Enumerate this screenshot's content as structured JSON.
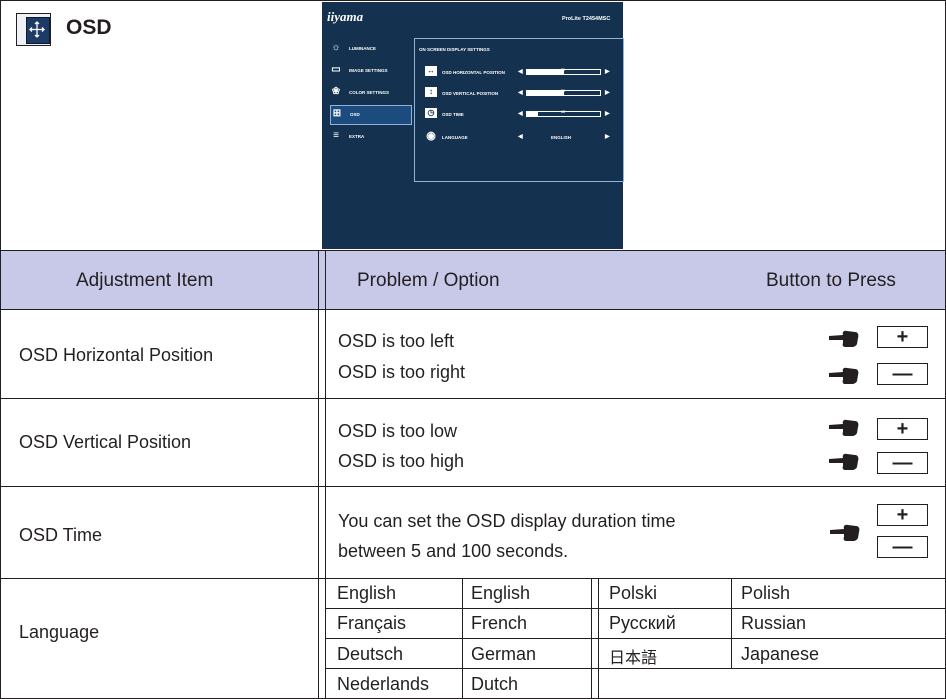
{
  "header": {
    "title": "OSD"
  },
  "monitor": {
    "brand": "iiyama",
    "model": "ProLite T2454MSC",
    "menu": [
      {
        "label": "LUMINANCE",
        "icon": "sun-icon"
      },
      {
        "label": "IMAGE SETTINGS",
        "icon": "image-icon"
      },
      {
        "label": "COLOR SETTINGS",
        "icon": "color-icon"
      },
      {
        "label": "OSD",
        "icon": "osd-icon"
      },
      {
        "label": "EXTRA",
        "icon": "sliders-icon"
      }
    ],
    "panel_title": "ON SCREEN DISPLAY SETTINGS",
    "rows": [
      {
        "label": "OSD HORIZONTAL POSITION",
        "value": "50",
        "level": 0.5
      },
      {
        "label": "OSD VERTICAL POSITION",
        "value": "50",
        "level": 0.5
      },
      {
        "label": "OSD TIME",
        "value": "15",
        "level": 0.15
      }
    ],
    "language_row": {
      "label": "LANGUAGE",
      "value": "ENGLISH"
    }
  },
  "table": {
    "col_adjustment": "Adjustment Item",
    "col_problem": "Problem / Option",
    "col_button": "Button to Press",
    "rows": [
      {
        "item": "OSD Horizontal Position",
        "lines": [
          "OSD is too left",
          "OSD is too right"
        ],
        "buttons": [
          "+",
          "—"
        ]
      },
      {
        "item": "OSD Vertical Position",
        "lines": [
          "OSD is too low",
          "OSD is too high"
        ],
        "buttons": [
          "+",
          "—"
        ]
      },
      {
        "item": "OSD Time",
        "lines": [
          "You can set the OSD display duration time",
          "between 5 and 100 seconds."
        ],
        "buttons": [
          "+",
          "—"
        ]
      }
    ],
    "language": {
      "item": "Language",
      "left": [
        [
          "English",
          "English"
        ],
        [
          "Français",
          "French"
        ],
        [
          "Deutsch",
          "German"
        ],
        [
          "Nederlands",
          "Dutch"
        ]
      ],
      "right": [
        [
          "Polski",
          "Polish"
        ],
        [
          "Русский",
          "Russian"
        ],
        [
          "日本語",
          "Japanese"
        ]
      ]
    }
  }
}
